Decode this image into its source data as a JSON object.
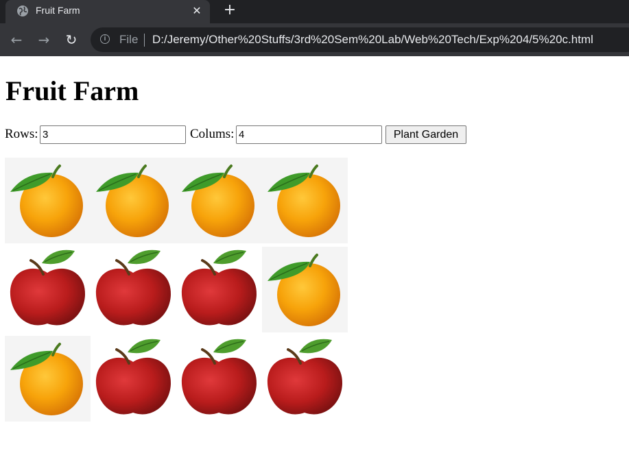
{
  "browser": {
    "tab_title": "Fruit Farm",
    "tab_close": "✕",
    "new_tab": "+",
    "back": "←",
    "forward": "→",
    "reload": "↻",
    "info": "i",
    "scheme": "File",
    "url": "D:/Jeremy/Other%20Stuffs/3rd%20Sem%20Lab/Web%20Tech/Exp%204/5%20c.html"
  },
  "page": {
    "heading": "Fruit Farm",
    "rows_label": "Rows:",
    "rows_value": "3",
    "cols_label": "Colums:",
    "cols_value": "4",
    "plant_button": "Plant Garden"
  },
  "garden": {
    "grid": [
      [
        "orange",
        "orange",
        "orange",
        "orange"
      ],
      [
        "apple",
        "apple",
        "apple",
        "orange"
      ],
      [
        "orange",
        "apple",
        "apple",
        "apple"
      ]
    ]
  },
  "colors": {
    "tab_bg": "#35363a",
    "strip_bg": "#202124",
    "orange": "#f59e0b",
    "apple": "#b91c1c",
    "leaf": "#3f9b2a"
  }
}
